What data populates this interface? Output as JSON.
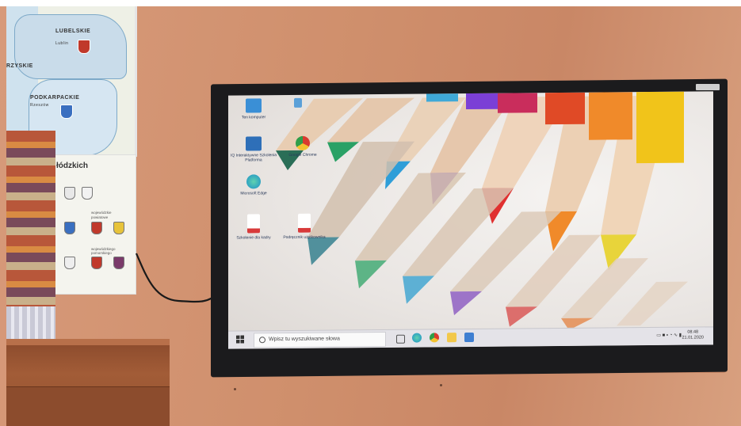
{
  "map": {
    "labels": [
      "LUBELSKIE",
      "Lublin",
      "RZYSKIE",
      "PODKARPACKIE",
      "Rzeszów"
    ]
  },
  "poster": {
    "title": "łódzkich",
    "labels": [
      "wojewódzkie",
      "powiatowe",
      "wojewódzkiego pomorskiego"
    ]
  },
  "desktop": {
    "icons": [
      {
        "name": "Ten komputer",
        "icon": "computer-icon",
        "color": "#3a8fd6"
      },
      {
        "name": "",
        "icon": "user-folder-icon",
        "color": "#5aa0d8"
      },
      {
        "name": "IQ Interaktywne Szkolenia Platforma",
        "icon": "iq-app-icon",
        "color": "#2e6fb8"
      },
      {
        "name": "Google Chrome",
        "icon": "chrome-icon",
        "color": "#e8b83a"
      },
      {
        "name": "Microsoft Edge",
        "icon": "edge-icon",
        "color": "#1b8fc9"
      },
      {
        "name": "Szkolenie dla kadry",
        "icon": "pdf-icon",
        "color": "#d83a3a"
      },
      {
        "name": "Podręcznik użytkownika",
        "icon": "pdf-icon",
        "color": "#d83a3a"
      }
    ],
    "wallpaper": "colored-pencils"
  },
  "taskbar": {
    "search_placeholder": "Wpisz tu wyszukiwane słowa",
    "apps": [
      {
        "icon": "task-view-icon",
        "color": "#555555"
      },
      {
        "icon": "edge-icon",
        "color": "#1b8fc9"
      },
      {
        "icon": "chrome-icon",
        "color": "#e8b83a"
      },
      {
        "icon": "file-explorer-icon",
        "color": "#f2c84b"
      },
      {
        "icon": "store-icon",
        "color": "#3f7fd1"
      }
    ],
    "time": "08:48",
    "date": "21.01.2020"
  }
}
